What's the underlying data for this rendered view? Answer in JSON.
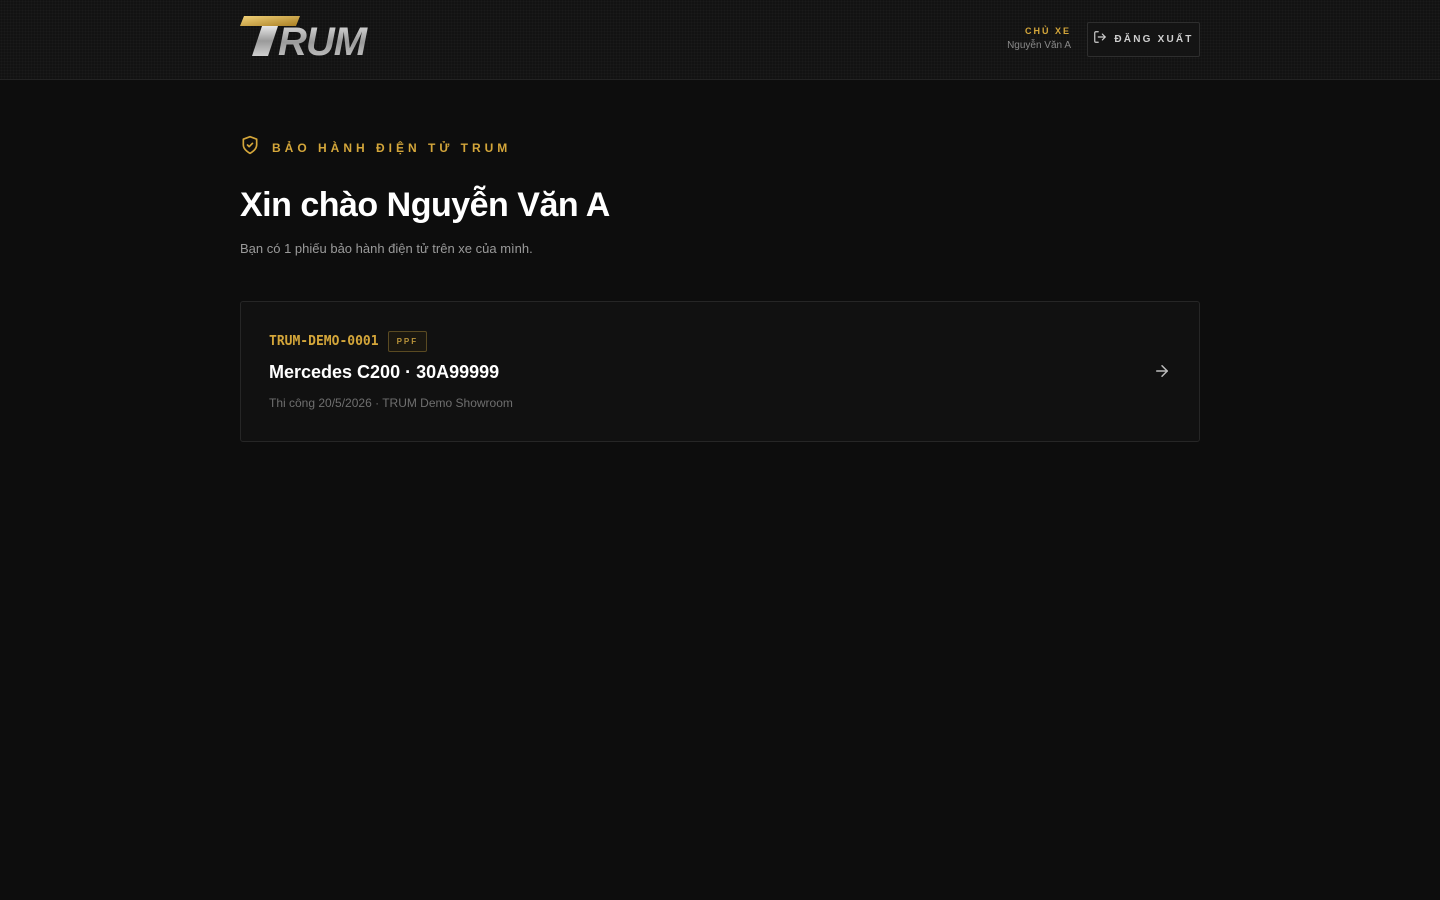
{
  "header": {
    "logo_text": "TRUM",
    "owner_label": "CHỦ XE",
    "owner_name": "Nguyễn Văn A",
    "logout_label": "ĐĂNG XUẤT",
    "logout_icon": "logout-icon"
  },
  "main": {
    "eyebrow_icon": "shield-check-icon",
    "eyebrow": "BẢO HÀNH ĐIỆN TỬ TRUM",
    "greeting": "Xin chào Nguyễn Văn A",
    "subtitle": "Bạn có 1 phiếu bảo hành điện tử trên xe của mình.",
    "warranties": [
      {
        "code": "TRUM-DEMO-0001",
        "badge": "PPF",
        "vehicle": "Mercedes C200 · 30A99999",
        "meta": "Thi công 20/5/2026 · TRUM Demo Showroom",
        "icon": "arrow-right-icon"
      }
    ]
  },
  "colors": {
    "background": "#0d0d0d",
    "accent_gold": "#d4a63a",
    "card_border": "#262626",
    "text_primary": "#ffffff",
    "text_muted": "#9a9a9a"
  }
}
